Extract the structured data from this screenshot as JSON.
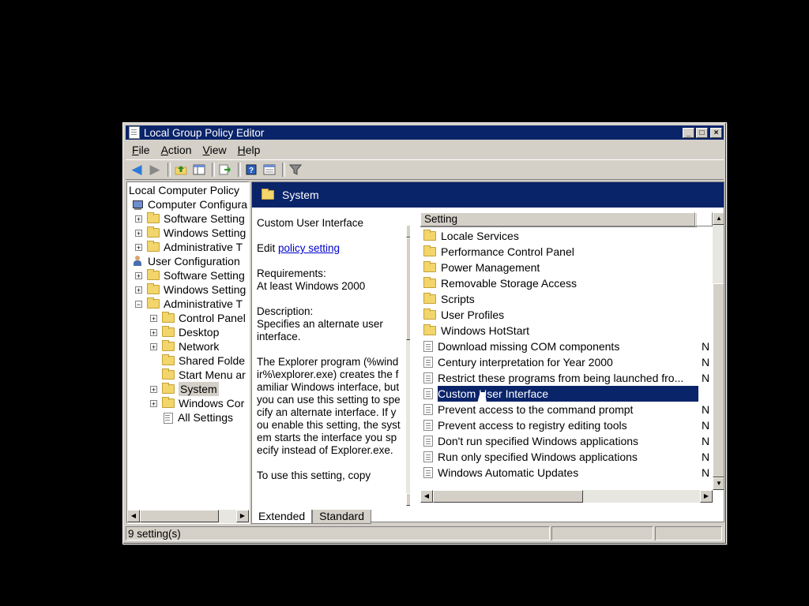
{
  "window": {
    "title": "Local Group Policy Editor",
    "controls": [
      "_",
      "□",
      "×"
    ]
  },
  "menu": [
    {
      "label": "File",
      "key": "F",
      "rest": "ile"
    },
    {
      "label": "Action",
      "key": "A",
      "rest": "ction"
    },
    {
      "label": "View",
      "key": "V",
      "rest": "iew"
    },
    {
      "label": "Help",
      "key": "H",
      "rest": "elp"
    }
  ],
  "toolbar": {
    "icons": [
      "back-icon",
      "forward-icon",
      "up-folder-icon",
      "show-hide-tree-icon",
      "export-list-icon",
      "help-icon",
      "properties-icon",
      "filter-icon"
    ]
  },
  "tree": {
    "items": [
      {
        "label": "Local Computer Policy",
        "icon": "policy-icon",
        "expander": ""
      },
      {
        "label": "Computer Configura",
        "icon": "computer-icon",
        "expander": ""
      },
      {
        "label": "Software Setting",
        "icon": "folder-icon",
        "expander": "+"
      },
      {
        "label": "Windows Setting",
        "icon": "folder-icon",
        "expander": "+"
      },
      {
        "label": "Administrative T",
        "icon": "folder-icon",
        "expander": "+"
      },
      {
        "label": "User Configuration",
        "icon": "user-icon",
        "expander": ""
      },
      {
        "label": "Software Setting",
        "icon": "folder-icon",
        "expander": "+"
      },
      {
        "label": "Windows Setting",
        "icon": "folder-icon",
        "expander": "+"
      },
      {
        "label": "Administrative T",
        "icon": "folder-icon",
        "expander": "−"
      },
      {
        "label": "Control Panel",
        "icon": "folder-icon",
        "expander": "+"
      },
      {
        "label": "Desktop",
        "icon": "folder-icon",
        "expander": "+"
      },
      {
        "label": "Network",
        "icon": "folder-icon",
        "expander": "+"
      },
      {
        "label": "Shared Folde",
        "icon": "folder-icon",
        "expander": ""
      },
      {
        "label": "Start Menu ar",
        "icon": "folder-icon",
        "expander": ""
      },
      {
        "label": "System",
        "icon": "folder-icon",
        "expander": "+",
        "selected": true
      },
      {
        "label": "Windows Cor",
        "icon": "folder-icon",
        "expander": "+"
      },
      {
        "label": "All Settings",
        "icon": "all-settings-icon",
        "expander": ""
      }
    ]
  },
  "banner": {
    "title": "System"
  },
  "description": {
    "title": "Custom User Interface",
    "edit_prefix": "Edit ",
    "edit_link": "policy setting",
    "requirements_label": "Requirements:",
    "requirements_value": "At least Windows 2000",
    "description_label": "Description:",
    "description_value": "Specifies an alternate user interface.",
    "body": "The Explorer program (%windir%\\explorer.exe) creates the familiar Windows interface, but you can use this setting to specify an alternate interface. If you enable this setting, the system starts the interface you specify instead of Explorer.exe.",
    "tail": "To use this setting, copy"
  },
  "list": {
    "column_setting": "Setting",
    "rows": [
      {
        "label": "Locale Services",
        "type": "folder",
        "state": ""
      },
      {
        "label": "Performance Control Panel",
        "type": "folder",
        "state": ""
      },
      {
        "label": "Power Management",
        "type": "folder",
        "state": ""
      },
      {
        "label": "Removable Storage Access",
        "type": "folder",
        "state": ""
      },
      {
        "label": "Scripts",
        "type": "folder",
        "state": ""
      },
      {
        "label": "User Profiles",
        "type": "folder",
        "state": ""
      },
      {
        "label": "Windows HotStart",
        "type": "folder",
        "state": ""
      },
      {
        "label": "Download missing COM components",
        "type": "setting",
        "state": "N"
      },
      {
        "label": "Century interpretation for Year 2000",
        "type": "setting",
        "state": "N"
      },
      {
        "label": "Restrict these programs from being launched fro...",
        "type": "setting",
        "state": "N"
      },
      {
        "label": "Custom User Interface",
        "type": "setting",
        "state": "",
        "selected": true
      },
      {
        "label": "Prevent access to the command prompt",
        "type": "setting",
        "state": "N"
      },
      {
        "label": "Prevent access to registry editing tools",
        "type": "setting",
        "state": "N"
      },
      {
        "label": "Don't run specified Windows applications",
        "type": "setting",
        "state": "N"
      },
      {
        "label": "Run only specified Windows applications",
        "type": "setting",
        "state": "N"
      },
      {
        "label": "Windows Automatic Updates",
        "type": "setting",
        "state": "N"
      }
    ]
  },
  "tabs": [
    {
      "label": "Extended",
      "active": true
    },
    {
      "label": "Standard",
      "active": false
    }
  ],
  "status": {
    "text": "9 setting(s)"
  }
}
